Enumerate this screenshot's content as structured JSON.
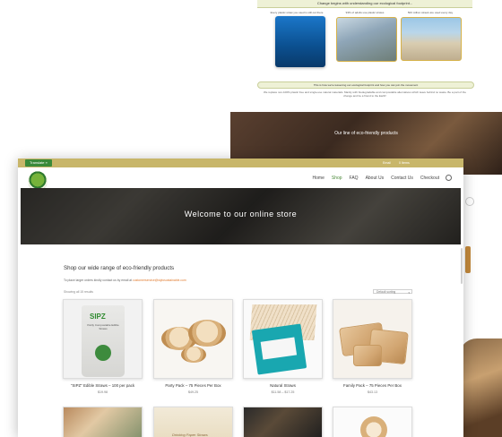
{
  "background_page": {
    "banner_title": "Change begins with understanding our ecological footprint...",
    "captions": [
      "Every plastic straw you used is still out there",
      "93% of adults use plastic straws",
      "500 million straws are used every day"
    ],
    "bar2_title": "This is how we're lessening our ecological footprint and how you can join the movement",
    "bar2_text": "We replace non-100% plastic free and single-use natural materials. Mainly with biodegradable and compostable alternatives which leave behind no waste. Be a part of the change and be a friend to the Earth!",
    "section_title": "Our line of eco-friendly products"
  },
  "topbar": {
    "translate_label": "Translate »",
    "email": "Email",
    "cart": "0 Items"
  },
  "nav": {
    "items": [
      "Home",
      "Shop",
      "FAQ",
      "About Us",
      "Contact Us",
      "Checkout"
    ],
    "active": "Shop"
  },
  "hero": {
    "title": "Welcome to our online store"
  },
  "shop": {
    "intro_title": "Shop our wide range of eco-friendly products",
    "intro_sub_prefix": "To place larger orders kindly contact us by email at ",
    "intro_sub_email": "customerservice@stylosustainable.com",
    "showing": "Showing all 15 results",
    "sort_label": "Default sorting"
  },
  "products": [
    {
      "name": "\"SIPZ\" Edible Straws – 100 per pack",
      "price": "$19.98"
    },
    {
      "name": "Party Pack – 75 Pieces Per Box",
      "price": "$49.25"
    },
    {
      "name": "Natural Straws",
      "price": "$11.58 – $17.25"
    },
    {
      "name": "Family Pack – 75 Pieces Per Box",
      "price": "$43.13"
    }
  ],
  "pouch": {
    "brand": "SIPZ",
    "text": "Partly Compostable Edible Straws"
  },
  "row2": {
    "label2": "Drinking Paper Straws"
  },
  "colors": {
    "topbar": "#c8b66a",
    "accent_green": "#4c8a3a",
    "link_orange": "#e07a2e"
  }
}
